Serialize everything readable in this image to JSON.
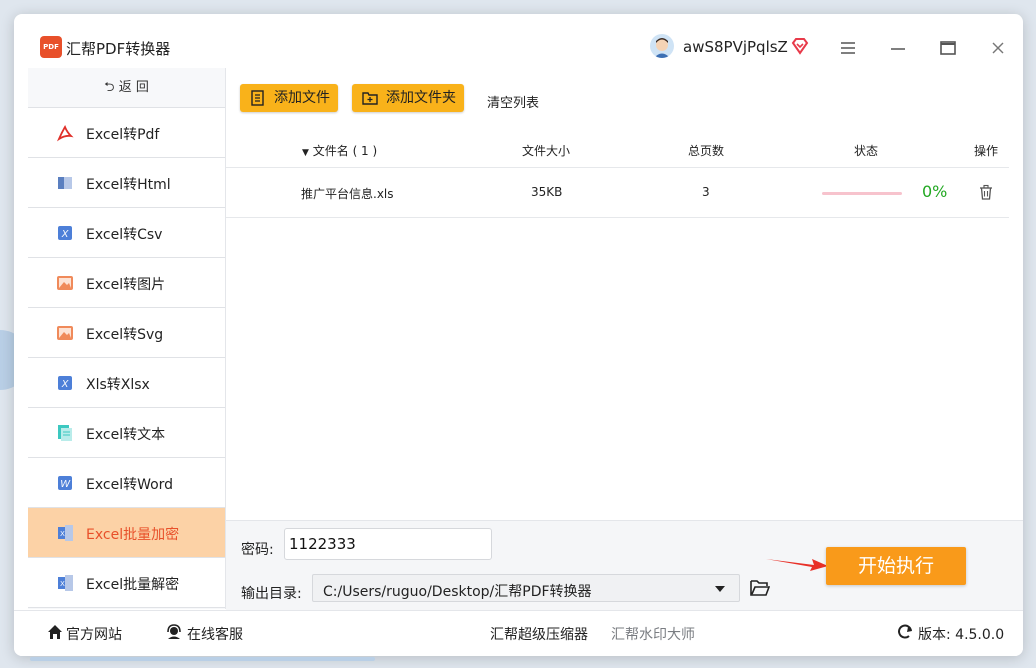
{
  "app": {
    "title": "汇帮PDF转换器",
    "logo_text": "PDF"
  },
  "user": {
    "name": "awS8PVjPqlsZ"
  },
  "sidebar": {
    "back_label": "返  回",
    "items": [
      {
        "label": "Excel转Pdf",
        "icon": "pdf-icon",
        "active": false
      },
      {
        "label": "Excel转Html",
        "icon": "html-icon",
        "active": false
      },
      {
        "label": "Excel转Csv",
        "icon": "csv-icon",
        "active": false
      },
      {
        "label": "Excel转图片",
        "icon": "image-icon",
        "active": false
      },
      {
        "label": "Excel转Svg",
        "icon": "svg-image-icon",
        "active": false
      },
      {
        "label": "Xls转Xlsx",
        "icon": "xls-icon",
        "active": false
      },
      {
        "label": "Excel转文本",
        "icon": "text-doc-icon",
        "active": false
      },
      {
        "label": "Excel转Word",
        "icon": "word-icon",
        "active": false
      },
      {
        "label": "Excel批量加密",
        "icon": "excel-lock-icon",
        "active": true
      },
      {
        "label": "Excel批量解密",
        "icon": "excel-unlock-icon",
        "active": false
      }
    ]
  },
  "toolbar": {
    "add_file": "添加文件",
    "add_folder": "添加文件夹",
    "clear_list": "清空列表"
  },
  "table": {
    "headers": {
      "name": "文件名 ( 1 )",
      "size": "文件大小",
      "pages": "总页数",
      "status": "状态",
      "action": "操作"
    },
    "rows": [
      {
        "name": "推广平台信息.xls",
        "size": "35KB",
        "pages": "3",
        "progress_pct": "0%",
        "progress": 0
      }
    ]
  },
  "form": {
    "password_label": "密码:",
    "password_value": "1122333",
    "output_label": "输出目录:",
    "output_path": "C:/Users/ruguo/Desktop/汇帮PDF转换器",
    "start_label": "开始执行"
  },
  "statusbar": {
    "website": "官方网站",
    "support": "在线客服",
    "compressor": "汇帮超级压缩器",
    "watermark": "汇帮水印大师",
    "version": "版本:  4.5.0.0"
  },
  "colors": {
    "accent": "#f9b21a",
    "active_item_bg": "#fcd2a6",
    "active_item_text": "#e8502a",
    "start_button": "#f99a1a",
    "progress_text": "#22a822"
  }
}
